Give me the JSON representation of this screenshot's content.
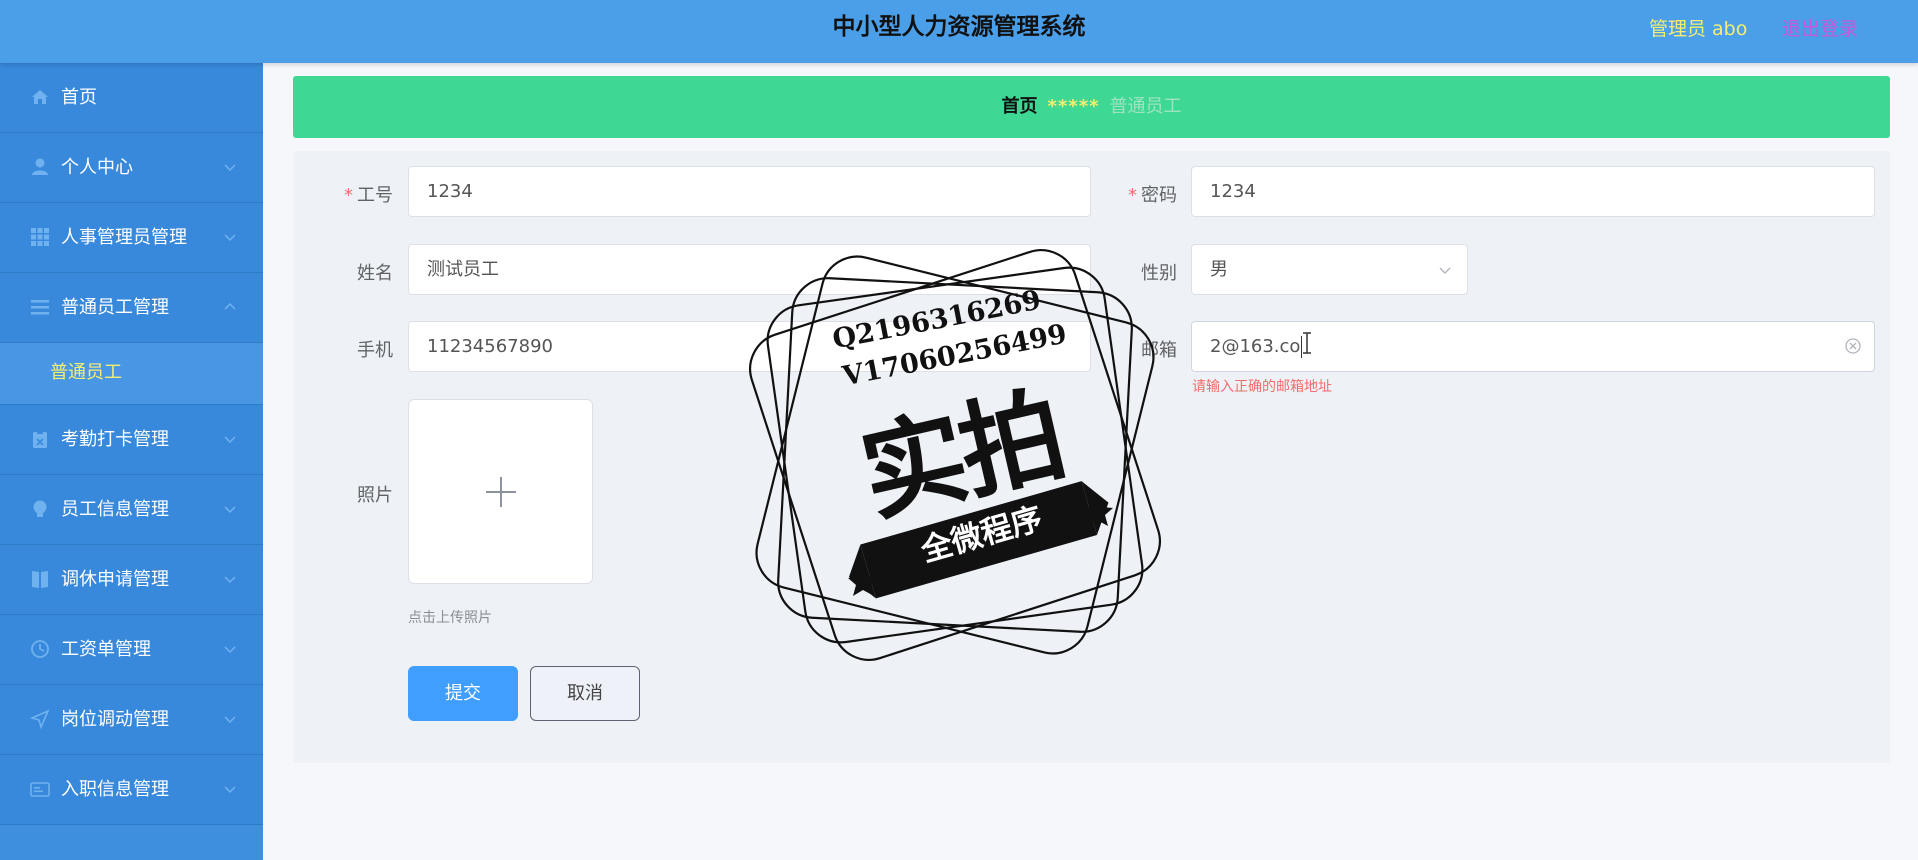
{
  "header": {
    "title": "中小型人力资源管理系统",
    "user": "管理员 abo",
    "logout": "退出登录"
  },
  "sidebar": {
    "items": [
      {
        "label": "首页",
        "icon": "home-icon"
      },
      {
        "label": "个人中心",
        "icon": "user-icon"
      },
      {
        "label": "人事管理员管理",
        "icon": "grid-icon"
      },
      {
        "label": "普通员工管理",
        "icon": "list-icon"
      },
      {
        "label": "考勤打卡管理",
        "icon": "clipboard-icon"
      },
      {
        "label": "员工信息管理",
        "icon": "bulb-icon"
      },
      {
        "label": "调休申请管理",
        "icon": "book-icon"
      },
      {
        "label": "工资单管理",
        "icon": "clock-icon"
      },
      {
        "label": "岗位调动管理",
        "icon": "send-icon"
      },
      {
        "label": "入职信息管理",
        "icon": "card-icon"
      }
    ],
    "subitems": [
      {
        "label": "普通员工"
      }
    ]
  },
  "breadcrumb": {
    "home": "首页",
    "separator": "*****",
    "current": "普通员工"
  },
  "form": {
    "job_no": {
      "label": "工号",
      "value": "1234"
    },
    "password": {
      "label": "密码",
      "value": "1234"
    },
    "name": {
      "label": "姓名",
      "value": "测试员工"
    },
    "gender": {
      "label": "性别",
      "value": "男"
    },
    "phone": {
      "label": "手机",
      "value": "11234567890"
    },
    "email": {
      "label": "邮箱",
      "value": "2@163.co",
      "error": "请输入正确的邮箱地址"
    },
    "photo": {
      "label": "照片",
      "tip": "点击上传照片"
    },
    "submit": "提交",
    "cancel": "取消"
  },
  "watermark": {
    "line1": "Q2196316269",
    "line2": "V17060256499",
    "main": "实拍",
    "ribbon": "全微程序"
  },
  "colors": {
    "header": "#4a9fe8",
    "sidebar": "#3889db",
    "breadcrumb_bar": "#3fd794",
    "accent_yellow": "#f4ef70",
    "logout": "#c25bd9",
    "primary": "#409eff",
    "error": "#f56c6c"
  }
}
